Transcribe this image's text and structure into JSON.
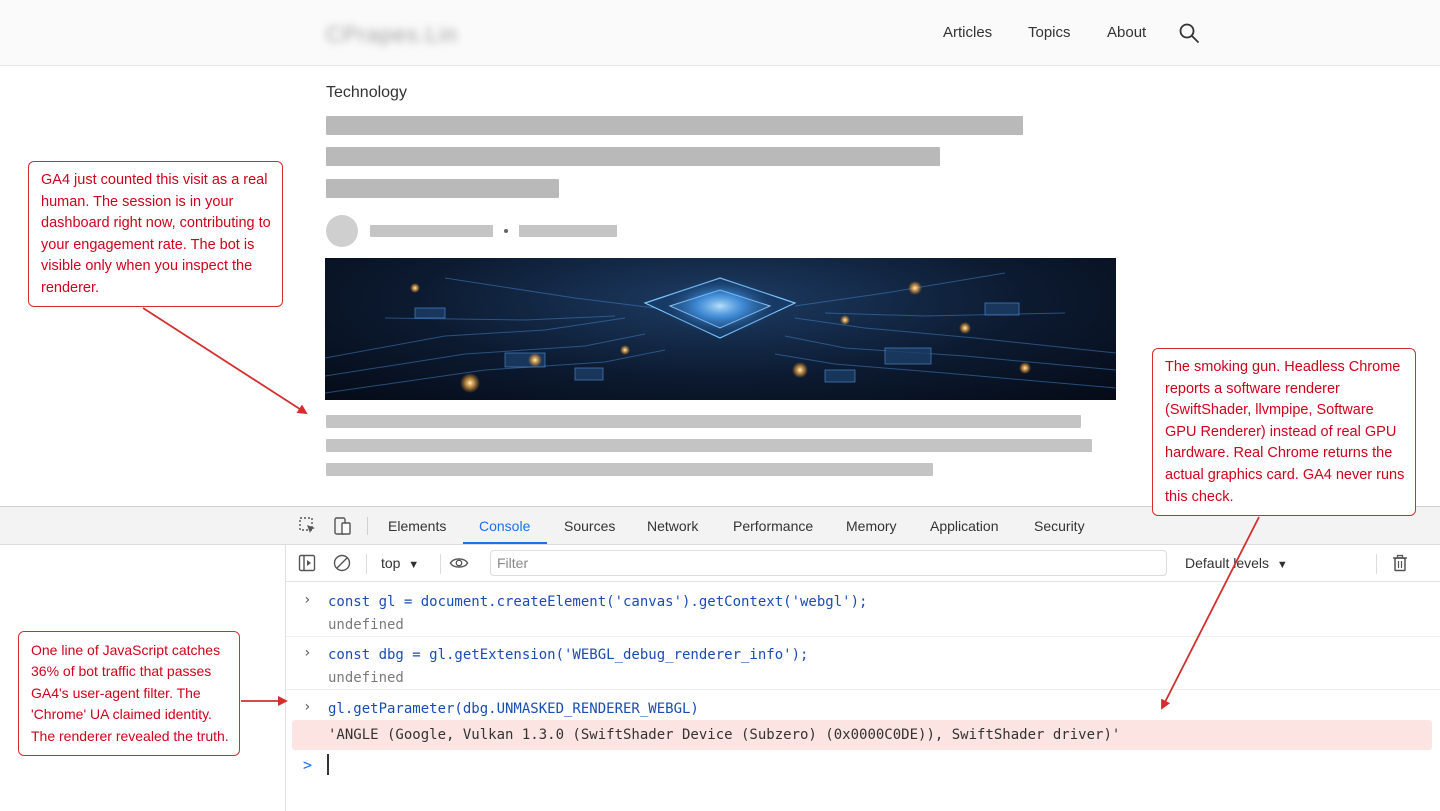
{
  "header": {
    "logo_text": "CPrapes.Lin",
    "nav": [
      "Articles",
      "Topics",
      "About"
    ],
    "search_icon": "search-icon"
  },
  "article": {
    "category": "Technology",
    "hero_image": "circuit-board-chip-image"
  },
  "devtools": {
    "tabs": [
      "Elements",
      "Console",
      "Sources",
      "Network",
      "Performance",
      "Memory",
      "Application",
      "Security"
    ],
    "active_tab": "Console",
    "toolbar": {
      "context": "top",
      "filter_placeholder": "Filter",
      "levels": "Default levels"
    },
    "console": {
      "lines": [
        {
          "input": "const gl = document.createElement('canvas').getContext('webgl');",
          "output": "undefined"
        },
        {
          "input": "const dbg = gl.getExtension('WEBGL_debug_renderer_info');",
          "output": "undefined"
        },
        {
          "input": "gl.getParameter(dbg.UNMASKED_RENDERER_WEBGL)",
          "output": "'ANGLE (Google, Vulkan 1.3.0 (SwiftShader Device (Subzero) (0x0000C0DE)), SwiftShader driver)'"
        }
      ],
      "prompt_symbol": ">"
    }
  },
  "annotations": {
    "top_left": "GA4 just counted this visit as a real human. The session is in your dashboard right now, contributing to your engagement rate. The bot is visible only when you inspect the renderer.",
    "right": "The smoking gun. Headless Chrome reports a software renderer (SwiftShader, llvmpipe, Software GPU Renderer) instead of real GPU hardware. Real Chrome returns the actual graphics card. GA4 never runs this check.",
    "bottom_left": "One line of JavaScript catches 36% of bot traffic that passes GA4's user-agent filter. The 'Chrome' UA claimed identity. The renderer revealed the truth.",
    "color": "#d0021b"
  }
}
